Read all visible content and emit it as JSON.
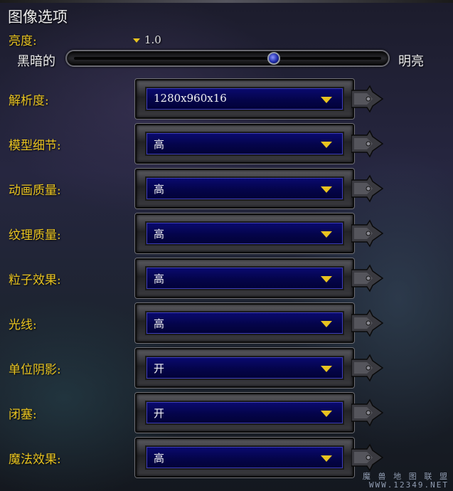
{
  "title": "图像选项",
  "brightness": {
    "label": "亮度:",
    "value": "1.0",
    "dark_label": "黑暗的",
    "bright_label": "明亮",
    "level": 0.65
  },
  "settings": [
    {
      "label": "解析度:",
      "value": "1280x960x16"
    },
    {
      "label": "模型细节:",
      "value": "高"
    },
    {
      "label": "动画质量:",
      "value": "高"
    },
    {
      "label": "纹理质量:",
      "value": "高"
    },
    {
      "label": "粒子效果:",
      "value": "高"
    },
    {
      "label": "光线:",
      "value": "高"
    },
    {
      "label": "单位阴影:",
      "value": "开"
    },
    {
      "label": "闭塞:",
      "value": "开"
    },
    {
      "label": "魔法效果:",
      "value": "高"
    }
  ],
  "watermark": {
    "line1": "魔 兽 地 图 联 盟",
    "line2": "WWW.12349.NET"
  },
  "colors": {
    "label": "#e8c320",
    "dropdown": "#04044a",
    "arrow": "#e8c320"
  }
}
